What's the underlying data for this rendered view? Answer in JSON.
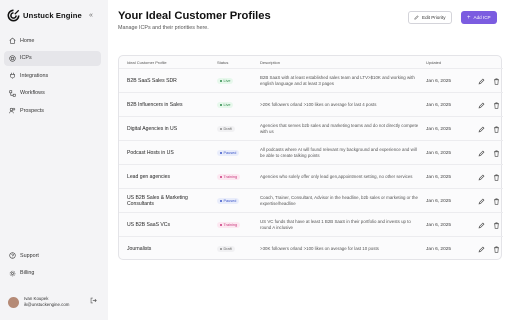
{
  "brand": {
    "name": "Unstuck Engine",
    "collapse_icon": "chevrons-left-icon"
  },
  "nav": [
    {
      "label": "Home",
      "icon": "home-icon",
      "active": false
    },
    {
      "label": "ICPs",
      "icon": "target-icon",
      "active": true
    },
    {
      "label": "Integrations",
      "icon": "plug-icon",
      "active": false
    },
    {
      "label": "Workflows",
      "icon": "workflow-icon",
      "active": false
    },
    {
      "label": "Prospects",
      "icon": "users-icon",
      "active": false
    }
  ],
  "nav_bottom": [
    {
      "label": "Support",
      "icon": "help-icon"
    },
    {
      "label": "Billing",
      "icon": "gear-icon"
    }
  ],
  "user": {
    "name": "Ivan Koupek",
    "email": "ik@unstuckengine.com"
  },
  "header": {
    "title": "Your Ideal Customer Profiles",
    "subtitle": "Manage ICPs and their priorities here.",
    "edit_label": "Edit Priority",
    "add_label": "Add ICP"
  },
  "table": {
    "columns": [
      "Ideal Customer Profile",
      "Status",
      "Description",
      "Updated"
    ],
    "rows": [
      {
        "name": "B2B SaaS Sales SDR",
        "status": "Live",
        "status_class": "live",
        "description": "B2B SaaS with at least established sales team and LTV>$10K and working with english language and at least 3 pages",
        "updated": "Jan 6, 2025"
      },
      {
        "name": "B2B Influencers in Sales",
        "status": "Live",
        "status_class": "live",
        "description": ">20K followers orland >100 likes on average for last 4 posts",
        "updated": "Jan 6, 2025"
      },
      {
        "name": "Digital Agencies in US",
        "status": "Draft",
        "status_class": "draft",
        "description": "Agencies that serves b2b sales and marketing teams and do not directly compete with us",
        "updated": "Jan 6, 2025"
      },
      {
        "name": "Podcast Hosts in US",
        "status": "Paused",
        "status_class": "paused",
        "description": "All podcasts where AI will found relevant my background and experience and will be able to create talking points",
        "updated": "Jan 6, 2025"
      },
      {
        "name": "Lead gen agencies",
        "status": "Training",
        "status_class": "training",
        "description": "Agencies who solely offer only lead gen,appointment setting, no other services",
        "updated": "Jan 6, 2025"
      },
      {
        "name": "US B2B Sales & Marketing Consultants",
        "status": "Paused",
        "status_class": "paused",
        "description": "Coach, Trainer, Consultant, Advisor in the headline, b2b sales or marketing or the expertise/headline",
        "updated": "Jan 6, 2025"
      },
      {
        "name": "US B2B SaaS VCs",
        "status": "Training",
        "status_class": "training",
        "description": "US VC funds that have at least 1 B2B SaaS in their portfolio and invests up to round A inclusive",
        "updated": "Jan 6, 2025"
      },
      {
        "name": "Journalists",
        "status": "Draft",
        "status_class": "draft",
        "description": ">30K followers orland >100 likes on average for last 10 posts",
        "updated": "Jan 6, 2025"
      }
    ]
  },
  "colors": {
    "accent": "#7b5ce0",
    "live": "#2e8b4a",
    "paused": "#3c57c9",
    "training": "#c9367b"
  }
}
